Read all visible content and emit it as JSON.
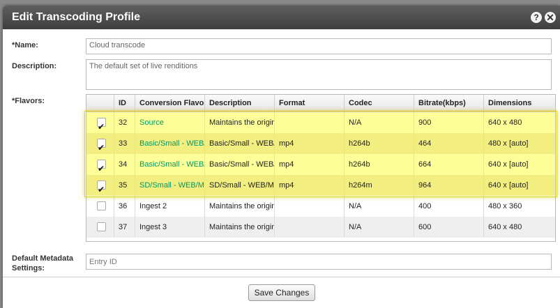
{
  "dialog": {
    "title": "Edit Transcoding Profile",
    "help_icon": "help-icon",
    "help_label": "?",
    "close_icon": "close-icon",
    "close_label": "✕"
  },
  "form": {
    "name_label": "*Name:",
    "name_value": "Cloud transcode",
    "description_label": "Description:",
    "description_value": "The default set of live renditions",
    "flavors_label": "*Flavors:",
    "metadata_label_line1": "Default Metadata",
    "metadata_label_line2": "Settings:",
    "metadata_placeholder": "Entry ID"
  },
  "grid": {
    "columns": [
      "",
      "ID",
      "Conversion Flavor",
      "Description",
      "Format",
      "Codec",
      "Bitrate(kbps)",
      "Dimensions"
    ],
    "rows": [
      {
        "checked": true,
        "id": "32",
        "name": "Source",
        "description": "Maintains the original",
        "format": "",
        "codec": "N/A",
        "bitrate": "900",
        "dimensions": "640 x 480"
      },
      {
        "checked": true,
        "id": "33",
        "name": "Basic/Small - WEB/MBL",
        "description": "Basic/Small - WEB/MBL",
        "format": "mp4",
        "codec": "h264b",
        "bitrate": "464",
        "dimensions": "480 x [auto]"
      },
      {
        "checked": true,
        "id": "34",
        "name": "Basic/Small - WEB/MBL",
        "description": "Basic/Small - WEB/MBL",
        "format": "mp4",
        "codec": "h264b",
        "bitrate": "664",
        "dimensions": "640 x [auto]"
      },
      {
        "checked": true,
        "id": "35",
        "name": "SD/Small - WEB/MBL",
        "description": "SD/Small - WEB/MBL",
        "format": "mp4",
        "codec": "h264m",
        "bitrate": "964",
        "dimensions": "640 x [auto]"
      },
      {
        "checked": false,
        "id": "36",
        "name": "Ingest 2",
        "description": "Maintains the original",
        "format": "",
        "codec": "N/A",
        "bitrate": "400",
        "dimensions": "480 x 360"
      },
      {
        "checked": false,
        "id": "37",
        "name": "Ingest 3",
        "description": "Maintains the original",
        "format": "",
        "codec": "N/A",
        "bitrate": "600",
        "dimensions": "640 x 480"
      }
    ]
  },
  "footer": {
    "save_label": "Save Changes"
  },
  "colors": {
    "selected_row": "#ffff99",
    "link_green": "#009966",
    "titlebar": "#4a4a4a"
  }
}
